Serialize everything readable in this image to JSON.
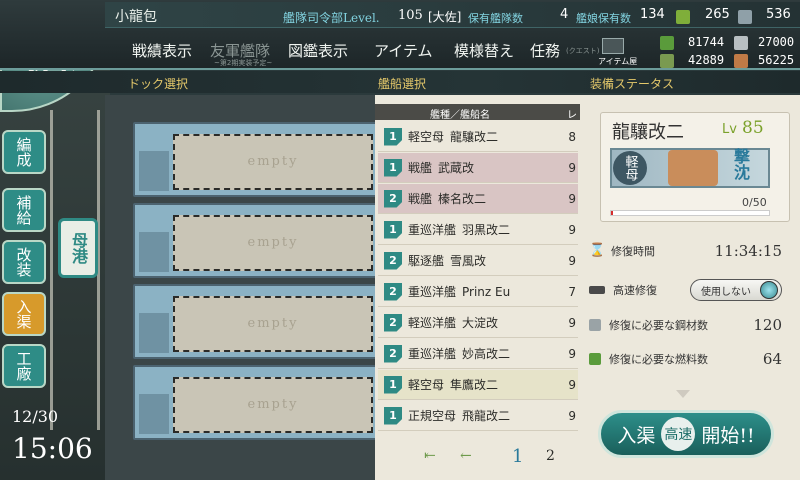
{
  "header": {
    "admiral_name": "小龍包",
    "hq_level_label": "艦隊司令部Level.",
    "hq_level": "105",
    "rank": "[大佐]",
    "fleet_count_label": "保有艦隊数",
    "fleet_count": "4",
    "ship_count_label": "艦娘保有数",
    "ship_count": "134",
    "buckets": "265",
    "dev_materials": "536"
  },
  "menu": {
    "items": [
      "戦績表示",
      "友軍艦隊",
      "図鑑表示",
      "アイテム",
      "模様替え",
      "任務"
    ],
    "ally_sub": "~第2期実装予定~",
    "quest_sub": "(クエスト)",
    "item_shop_label": "アイテム屋"
  },
  "resources": {
    "fuel": "81744",
    "ammo": "42889",
    "steel": "27000",
    "bauxite": "56225"
  },
  "sections": {
    "dock": "ドック選択",
    "ship": "艦船選択",
    "status": "装備ステータス"
  },
  "side": {
    "buttons": [
      "編成",
      "補給",
      "改装",
      "入渠",
      "工廠"
    ],
    "return": "母港",
    "date": "12/30",
    "time": "15:06"
  },
  "docks": {
    "empty_label": "empty"
  },
  "ship_list": {
    "header_type": "艦種／艦船名",
    "header_lv": "レ",
    "rows": [
      {
        "num": "1",
        "type": "軽空母",
        "name": "龍驤改二",
        "lv": "8"
      },
      {
        "num": "1",
        "type": "戦艦",
        "name": "武蔵改",
        "lv": "9"
      },
      {
        "num": "2",
        "type": "戦艦",
        "name": "榛名改二",
        "lv": "9"
      },
      {
        "num": "1",
        "type": "重巡洋艦",
        "name": "羽黒改二",
        "lv": "9"
      },
      {
        "num": "2",
        "type": "駆逐艦",
        "name": "雪風改",
        "lv": "9"
      },
      {
        "num": "2",
        "type": "重巡洋艦",
        "name": "Prinz Eu",
        "lv": "7"
      },
      {
        "num": "2",
        "type": "軽巡洋艦",
        "name": "大淀改",
        "lv": "9"
      },
      {
        "num": "2",
        "type": "重巡洋艦",
        "name": "妙高改二",
        "lv": "9"
      },
      {
        "num": "1",
        "type": "軽空母",
        "name": "隼鷹改二",
        "lv": "9"
      },
      {
        "num": "1",
        "type": "正規空母",
        "name": "飛龍改二",
        "lv": "9"
      }
    ],
    "pages": [
      "1",
      "2"
    ]
  },
  "status": {
    "ship_name": "龍驤改二",
    "lv_label": "Lv",
    "lv": "85",
    "class_badge": "軽母",
    "tag": "撃沈",
    "hp_text": "0/50",
    "hp_fraction": 0.0,
    "repair_time_label": "修復時間",
    "repair_time": "11:34:15",
    "fast_repair_label": "高速修復",
    "fast_repair_state": "使用しない",
    "steel_label": "修復に必要な鋼材数",
    "steel": "120",
    "fuel_label": "修復に必要な燃料数",
    "fuel": "64",
    "start_left": "入渠",
    "start_mid": "高速",
    "start_right": "開始!!"
  },
  "colors": {
    "accent": "#2e8a84",
    "section_text": "#e4c86a",
    "highlight_row": "#d9c5c4",
    "level_green": "#7aa12a"
  }
}
